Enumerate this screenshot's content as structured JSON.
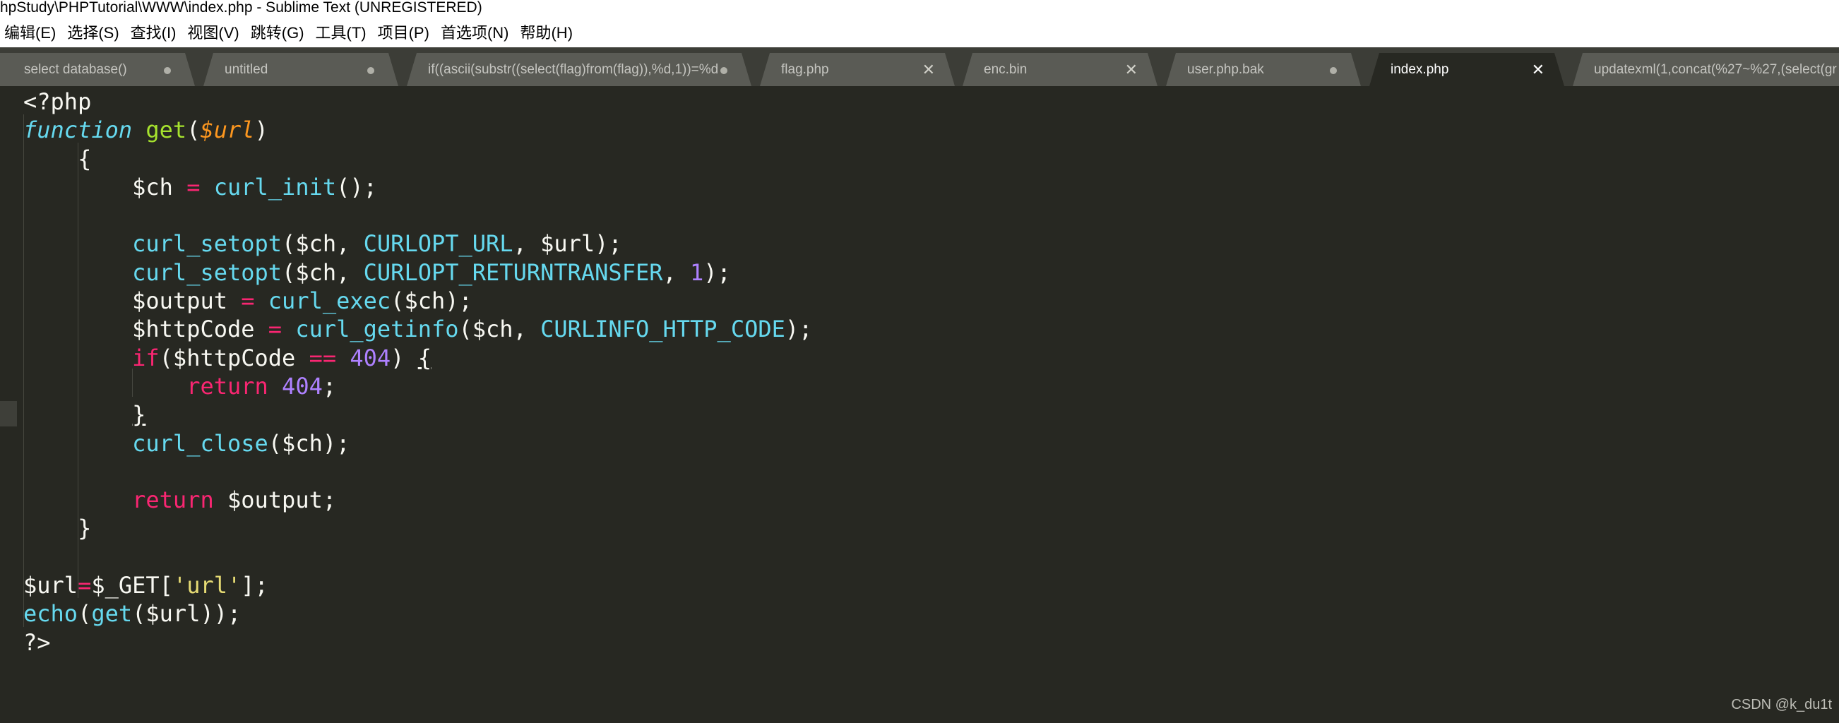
{
  "window": {
    "title": "hpStudy\\PHPTutorial\\WWW\\index.php - Sublime Text (UNREGISTERED)"
  },
  "menu": [
    {
      "label": "编辑(E)",
      "name": "menu-edit"
    },
    {
      "label": "选择(S)",
      "name": "menu-selection"
    },
    {
      "label": "查找(I)",
      "name": "menu-find"
    },
    {
      "label": "视图(V)",
      "name": "menu-view"
    },
    {
      "label": "跳转(G)",
      "name": "menu-goto"
    },
    {
      "label": "工具(T)",
      "name": "menu-tools"
    },
    {
      "label": "项目(P)",
      "name": "menu-project"
    },
    {
      "label": "首选项(N)",
      "name": "menu-preferences"
    },
    {
      "label": "帮助(H)",
      "name": "menu-help"
    }
  ],
  "tabs": [
    {
      "label": "select database()",
      "state": "dirty",
      "active": false
    },
    {
      "label": "untitled",
      "state": "dirty",
      "active": false
    },
    {
      "label": "if((ascii(substr((select(flag)from(flag)),%d,1))=%d",
      "state": "dirty",
      "active": false
    },
    {
      "label": "flag.php",
      "state": "close",
      "active": false
    },
    {
      "label": "enc.bin",
      "state": "close",
      "active": false
    },
    {
      "label": "user.php.bak",
      "state": "dirty",
      "active": false
    },
    {
      "label": "index.php",
      "state": "close",
      "active": true
    },
    {
      "label": "updatexml(1,concat(%27~%27,(select(gr",
      "state": "none",
      "active": false
    }
  ],
  "editor": {
    "language": "php",
    "lines": [
      "<?php",
      "function get($url)",
      "    {",
      "        $ch = curl_init();",
      "",
      "        curl_setopt($ch, CURLOPT_URL, $url);",
      "        curl_setopt($ch, CURLOPT_RETURNTRANSFER, 1);",
      "        $output = curl_exec($ch);",
      "        $httpCode = curl_getinfo($ch, CURLINFO_HTTP_CODE);",
      "        if($httpCode == 404) {",
      "            return 404;",
      "        }",
      "        curl_close($ch);",
      "",
      "        return $output;",
      "    }",
      "",
      "$url=$_GET['url'];",
      "echo(get($url));",
      "?>"
    ]
  },
  "watermark": "CSDN @k_du1t",
  "colors": {
    "editor_bg": "#272822",
    "keyword": "#f92672",
    "function_name": "#a6e22e",
    "builtin": "#66d9ef",
    "number": "#ae81ff",
    "string": "#e6db74",
    "parameter": "#fd971f"
  }
}
